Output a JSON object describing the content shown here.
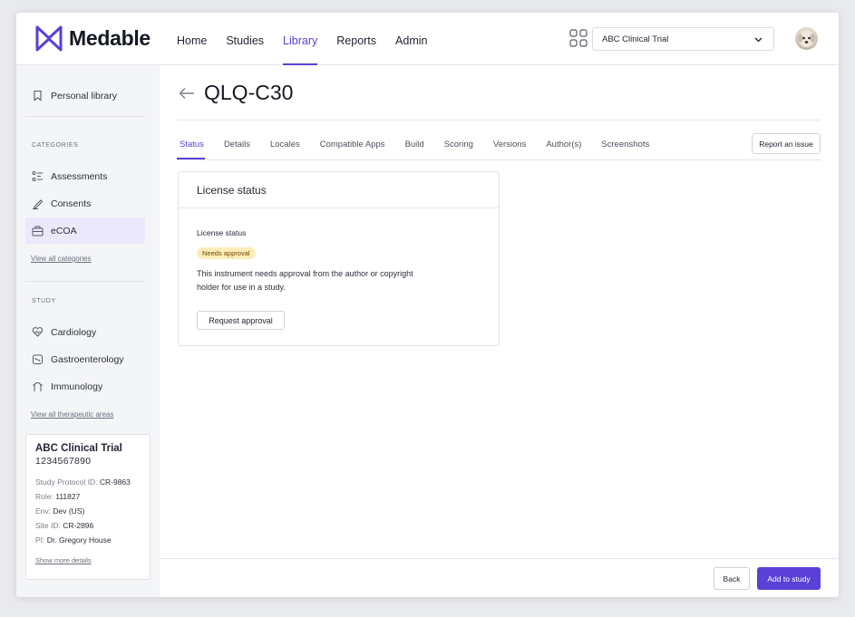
{
  "brand": {
    "name": "Medable",
    "logo_icon": "medable-logo-icon",
    "accent": "#5a40d6"
  },
  "nav": [
    {
      "label": "Home",
      "active": false
    },
    {
      "label": "Studies",
      "active": false
    },
    {
      "label": "Library",
      "active": true
    },
    {
      "label": "Reports",
      "active": false
    },
    {
      "label": "Admin",
      "active": false
    }
  ],
  "header": {
    "apps_icon": "grid-apps-icon",
    "study_select": {
      "value": "ABC Clinical Trial",
      "icon": "chevron-down-icon"
    },
    "avatar_icon": "user-avatar"
  },
  "sidebar": {
    "personal": {
      "label": "Personal library",
      "icon": "bookmark-icon"
    },
    "categories_heading": "CATEGORIES",
    "categories": [
      {
        "label": "Assessments",
        "icon": "list-icon",
        "active": false
      },
      {
        "label": "Consents",
        "icon": "pen-icon",
        "active": false
      },
      {
        "label": "eCOA",
        "icon": "device-icon",
        "active": true
      }
    ],
    "view_all_categories": "View all categories",
    "study_heading": "STUDY",
    "areas": [
      {
        "label": "Cardiology",
        "icon": "heart-icon"
      },
      {
        "label": "Gastroenterology",
        "icon": "stomach-icon"
      },
      {
        "label": "Immunology",
        "icon": "antibody-icon"
      }
    ],
    "view_all_areas": "View all therapeutic areas",
    "study_card": {
      "title": "ABC Clinical Trial",
      "number": "1234567890",
      "rows": [
        {
          "key": "Study Protocol ID: ",
          "value": "CR-9863"
        },
        {
          "key": "Role: ",
          "value": "111827"
        },
        {
          "key": "Env: ",
          "value": "Dev (US)"
        },
        {
          "key": "Site ID: ",
          "value": "CR-2896"
        },
        {
          "key": "PI: ",
          "value": "Dr. Gregory House"
        }
      ],
      "more": "Show more details"
    }
  },
  "main": {
    "back_icon": "arrow-left-icon",
    "title": "QLQ-C30",
    "tabs": [
      {
        "label": "Status",
        "active": true
      },
      {
        "label": "Details",
        "active": false
      },
      {
        "label": "Locales",
        "active": false
      },
      {
        "label": "Compatible Apps",
        "active": false
      },
      {
        "label": "Build",
        "active": false
      },
      {
        "label": "Scoring",
        "active": false
      },
      {
        "label": "Versions",
        "active": false
      },
      {
        "label": "Author(s)",
        "active": false
      },
      {
        "label": "Screenshots",
        "active": false
      }
    ],
    "report_button": "Report an issue",
    "card": {
      "title": "License status",
      "label": "License status",
      "badge": "Needs approval",
      "badge_color": "#fdecb8",
      "text": "This instrument needs approval from the author or copyright holder for use in a study.",
      "button": "Request approval"
    }
  },
  "footer": {
    "back": "Back",
    "add": "Add to study"
  }
}
